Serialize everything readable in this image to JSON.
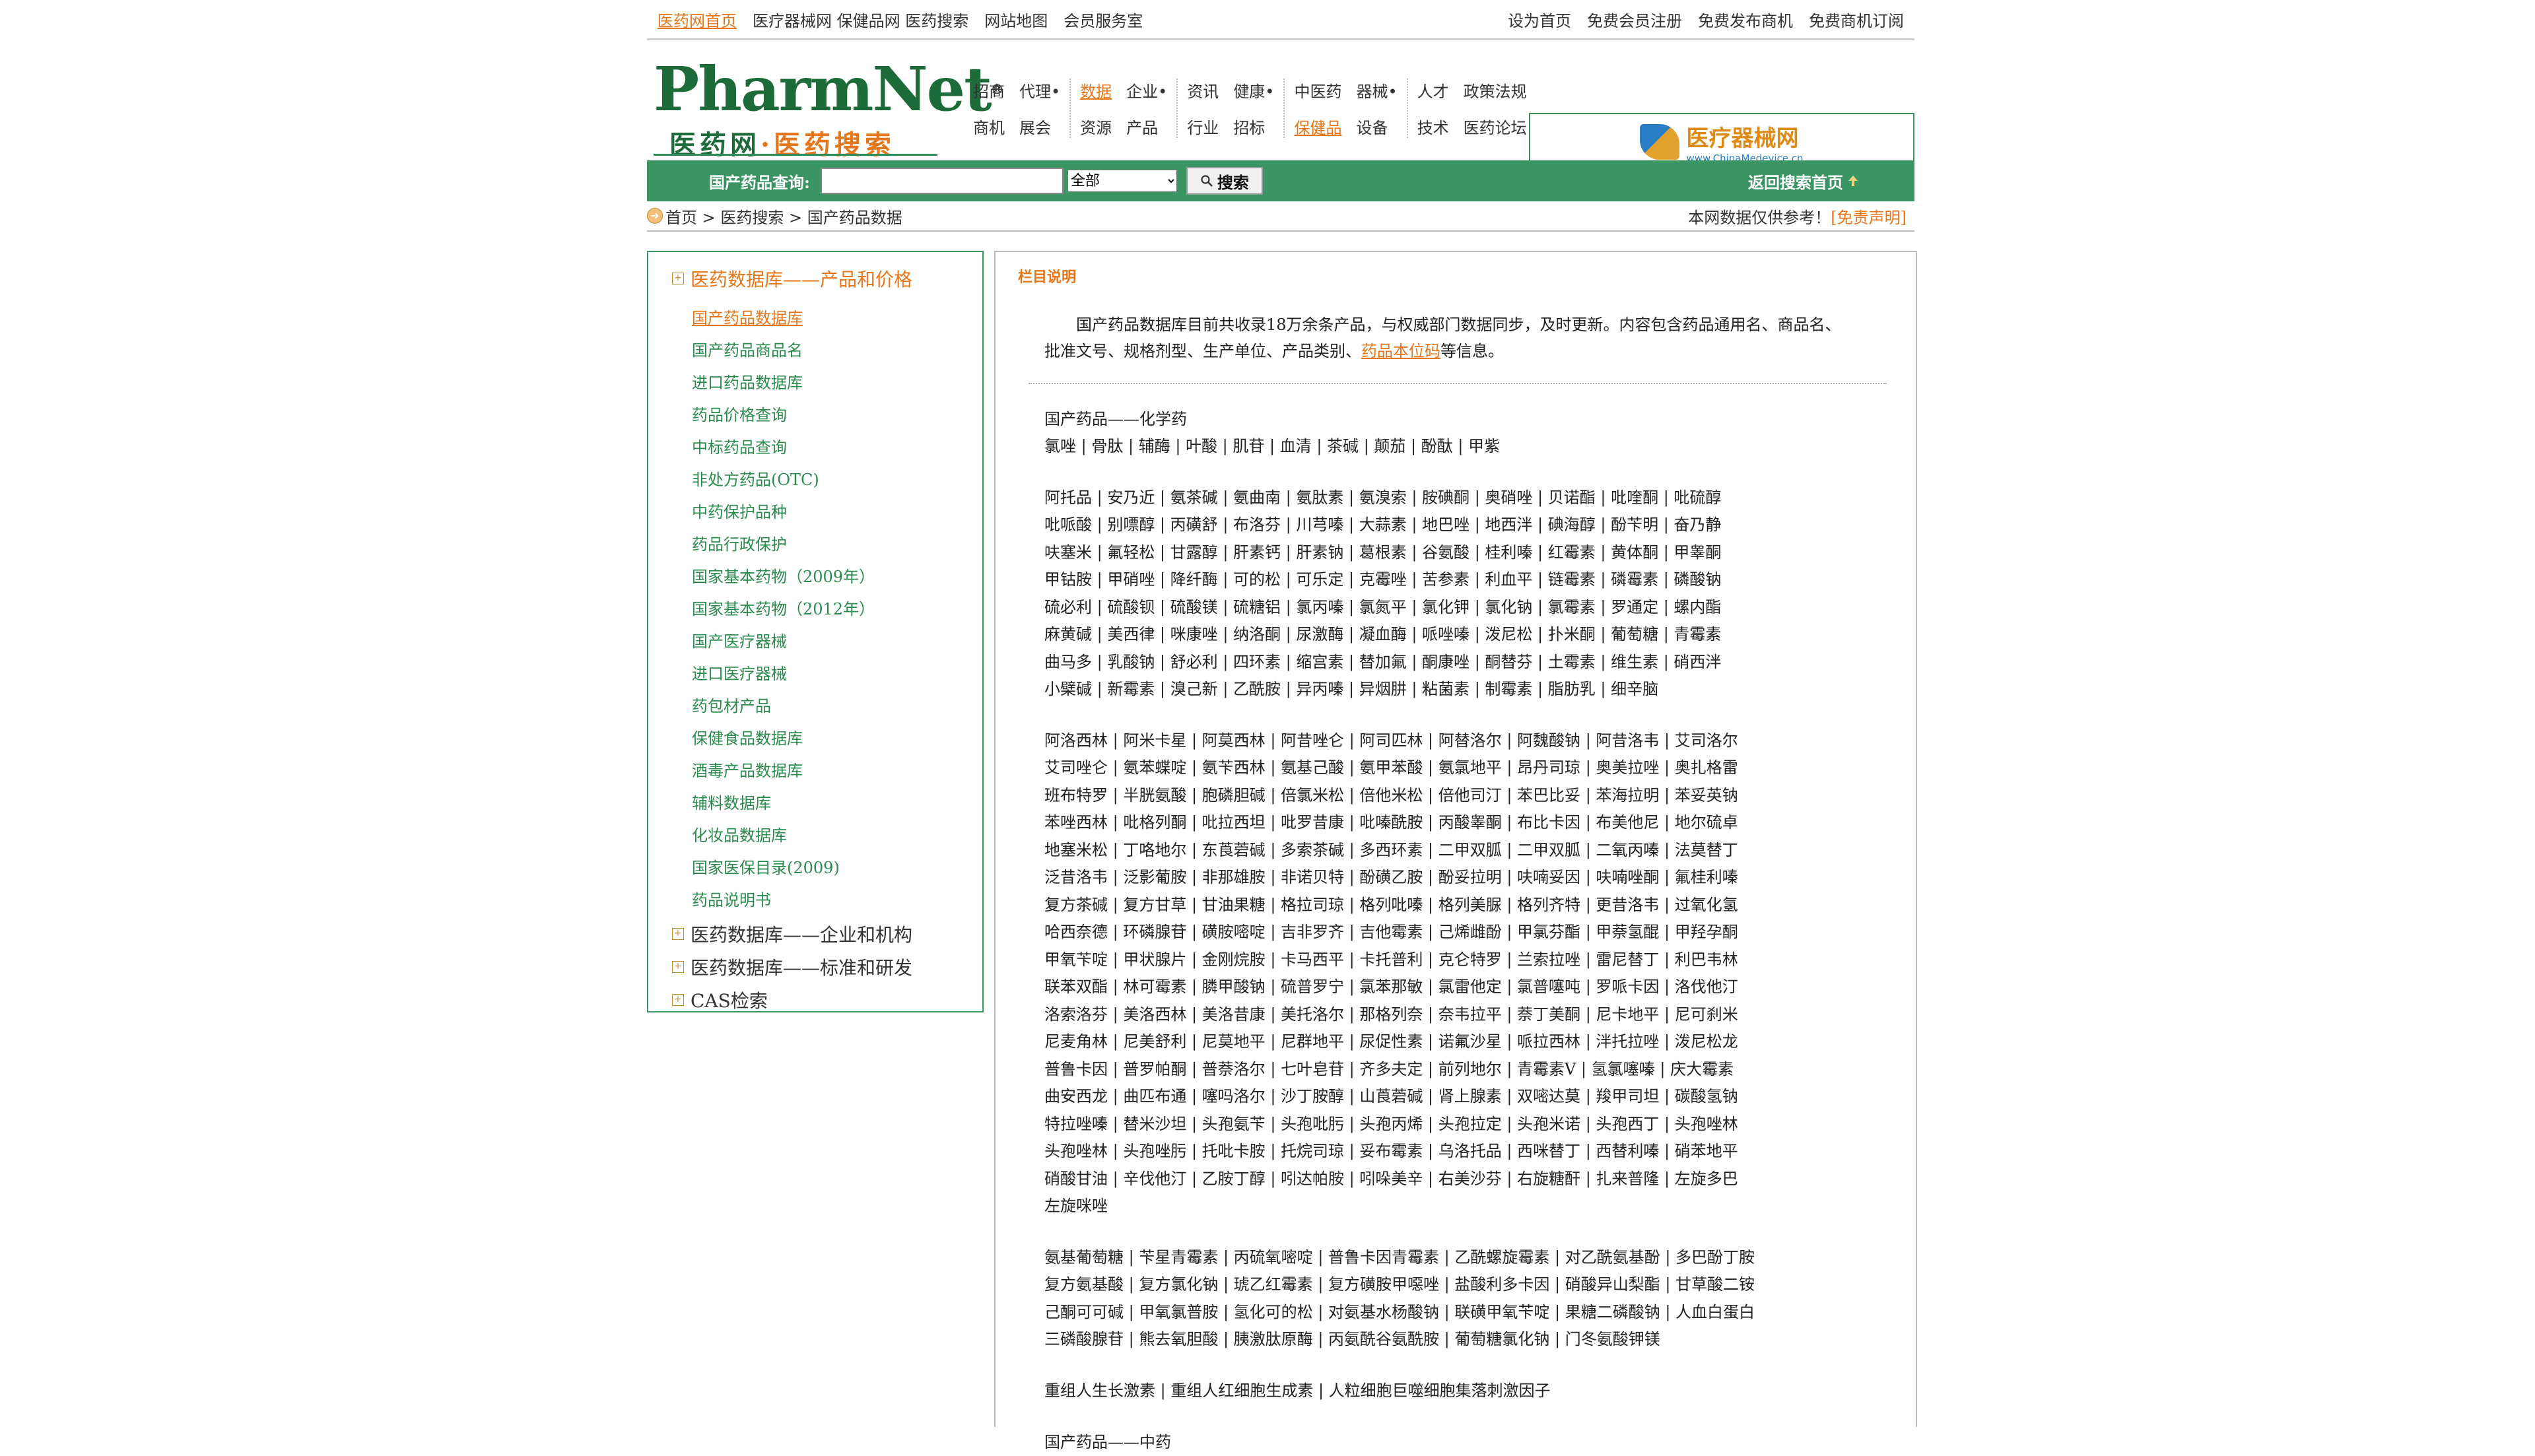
{
  "topbar": {
    "left": [
      "医药网首页",
      "医疗器械网 保健品网 医药搜索",
      "网站地图",
      "会员服务室"
    ],
    "right": [
      "设为首页",
      "免费会员注册",
      "免费发布商机",
      "免费商机订阅"
    ]
  },
  "logo": {
    "brand": "PharmNet",
    "reg": "®",
    "sub1": "医药网",
    "dot": "·",
    "sub2": "医药搜索"
  },
  "nav": {
    "col1": [
      [
        "招商",
        "代理•"
      ],
      [
        "商机",
        "展会"
      ]
    ],
    "col2": [
      [
        "数据",
        "企业•"
      ],
      [
        "资源",
        "产品"
      ]
    ],
    "col3": [
      [
        "资讯",
        "健康•"
      ],
      [
        "行业",
        "招标"
      ]
    ],
    "col4": [
      [
        "中医药",
        "器械•"
      ],
      [
        "保健品",
        "设备"
      ]
    ],
    "col5": [
      [
        "人才",
        "政策法规"
      ],
      [
        "技术",
        "医药论坛"
      ]
    ]
  },
  "banner": {
    "title": "医疗器械网",
    "url": "www.ChinaMedevice.cn"
  },
  "search": {
    "label": "国产药品查询:",
    "value": "",
    "select_value": "全部",
    "button": "搜索",
    "back": "返回搜索首页"
  },
  "crumbs": {
    "path": "首页 > 医药搜索 > 国产药品数据",
    "notice": "本网数据仅供参考！",
    "disclaimer": "[免责声明]"
  },
  "left": {
    "section1": "医药数据库——产品和价格",
    "items": [
      "国产药品数据库",
      "国产药品商品名",
      "进口药品数据库",
      "药品价格查询",
      "中标药品查询",
      "非处方药品(OTC)",
      "中药保护品种",
      "药品行政保护",
      "国家基本药物（2009年）",
      "国家基本药物（2012年）",
      "国产医疗器械",
      "进口医疗器械",
      "药包材产品",
      "保健食品数据库",
      "酒毒产品数据库",
      "辅料数据库",
      "化妆品数据库",
      "国家医保目录(2009)",
      "药品说明书"
    ],
    "section2": "医药数据库——企业和机构",
    "section3": "医药数据库——标准和研发",
    "section4": "CAS检索"
  },
  "right": {
    "title": "栏目说明",
    "intro1": "国产药品数据库目前共收录18万余条产品，与权威部门数据同步，及时更新。内容包含药品通用名、商品名、批准文号、规格剂型、生产单位、产品类别、",
    "intro_link": "药品本位码",
    "intro2": "等信息。",
    "sec_title": "国产药品——化学药",
    "group1": [
      "氯唑 | 骨肽 | 辅酶 | 叶酸 | 肌苷 | 血清 | 茶碱 | 颠茄 | 酚酞 | 甲紫"
    ],
    "group2": [
      "阿托品 | 安乃近 | 氨茶碱 | 氨曲南 | 氨肽素 | 氨溴索 | 胺碘酮 | 奥硝唑 | 贝诺酯 | 吡喹酮 | 吡硫醇",
      "吡哌酸 | 别嘌醇 | 丙磺舒 | 布洛芬 | 川芎嗪 | 大蒜素 | 地巴唑 | 地西泮 | 碘海醇 | 酚苄明 | 奋乃静",
      "呋塞米 | 氟轻松 | 甘露醇 | 肝素钙 | 肝素钠 | 葛根素 | 谷氨酸 | 桂利嗪 | 红霉素 | 黄体酮 | 甲睾酮",
      "甲钴胺 | 甲硝唑 | 降纤酶 | 可的松 | 可乐定 | 克霉唑 | 苦参素 | 利血平 | 链霉素 | 磷霉素 | 磷酸钠",
      "硫必利 | 硫酸钡 | 硫酸镁 | 硫糖铝 | 氯丙嗪 | 氯氮平 | 氯化钾 | 氯化钠 | 氯霉素 | 罗通定 | 螺内酯",
      "麻黄碱 | 美西律 | 咪康唑 | 纳洛酮 | 尿激酶 | 凝血酶 | 哌唑嗪 | 泼尼松 | 扑米酮 | 葡萄糖 | 青霉素",
      "曲马多 | 乳酸钠 | 舒必利 | 四环素 | 缩宫素 | 替加氟 | 酮康唑 | 酮替芬 | 土霉素 | 维生素 | 硝西泮",
      "小檗碱 | 新霉素 | 溴己新 | 乙酰胺 | 异丙嗪 | 异烟肼 | 粘菌素 | 制霉素 | 脂肪乳 | 细辛脑"
    ],
    "group3": [
      "阿洛西林 | 阿米卡星 | 阿莫西林 | 阿昔唑仑 | 阿司匹林 | 阿替洛尔 | 阿魏酸钠 | 阿昔洛韦 | 艾司洛尔",
      "艾司唑仑 | 氨苯蝶啶 | 氨苄西林 | 氨基己酸 | 氨甲苯酸 | 氨氯地平 | 昂丹司琼 | 奥美拉唑 | 奥扎格雷",
      "班布特罗 | 半胱氨酸 | 胞磷胆碱 | 倍氯米松 | 倍他米松 | 倍他司汀 | 苯巴比妥 | 苯海拉明 | 苯妥英钠",
      "苯唑西林 | 吡格列酮 | 吡拉西坦 | 吡罗昔康 | 吡嗪酰胺 | 丙酸睾酮 | 布比卡因 | 布美他尼 | 地尔硫卓",
      "地塞米松 | 丁咯地尔 | 东莨菪碱 | 多索茶碱 | 多西环素 | 二甲双胍 | 二甲双胍 | 二氧丙嗪 | 法莫替丁",
      "泛昔洛韦 | 泛影葡胺 | 非那雄胺 | 非诺贝特 | 酚磺乙胺 | 酚妥拉明 | 呋喃妥因 | 呋喃唑酮 | 氟桂利嗪",
      "复方茶碱 | 复方甘草 | 甘油果糖 | 格拉司琼 | 格列吡嗪 | 格列美脲 | 格列齐特 | 更昔洛韦 | 过氧化氢",
      "哈西奈德 | 环磷腺苷 | 磺胺嘧啶 | 吉非罗齐 | 吉他霉素 | 己烯雌酚 | 甲氯芬酯 | 甲萘氢醌 | 甲羟孕酮",
      "甲氧苄啶 | 甲状腺片 | 金刚烷胺 | 卡马西平 | 卡托普利 | 克仑特罗 | 兰索拉唑 | 雷尼替丁 | 利巴韦林",
      "联苯双酯 | 林可霉素 | 膦甲酸钠 | 硫普罗宁 | 氯苯那敏 | 氯雷他定 | 氯普噻吨 | 罗哌卡因 | 洛伐他汀",
      "洛索洛芬 | 美洛西林 | 美洛昔康 | 美托洛尔 | 那格列奈 | 奈韦拉平 | 萘丁美酮 | 尼卡地平 | 尼可刹米",
      "尼麦角林 | 尼美舒利 | 尼莫地平 | 尼群地平 | 尿促性素 | 诺氟沙星 | 哌拉西林 | 泮托拉唑 | 泼尼松龙",
      "普鲁卡因 | 普罗帕酮 | 普萘洛尔 | 七叶皂苷 | 齐多夫定 | 前列地尔 | 青霉素V | 氢氯噻嗪 | 庆大霉素",
      "曲安西龙 | 曲匹布通 | 噻吗洛尔 | 沙丁胺醇 | 山莨菪碱 | 肾上腺素 | 双嘧达莫 | 羧甲司坦 | 碳酸氢钠",
      "特拉唑嗪 | 替米沙坦 | 头孢氨苄 | 头孢吡肟 | 头孢丙烯 | 头孢拉定 | 头孢米诺 | 头孢西丁 | 头孢唑林",
      "头孢唑林 | 头孢唑肟 | 托吡卡胺 | 托烷司琼 | 妥布霉素 | 乌洛托品 | 西咪替丁 | 西替利嗪 | 硝苯地平",
      "硝酸甘油 | 辛伐他汀 | 乙胺丁醇 | 吲达帕胺 | 吲哚美辛 | 右美沙芬 | 右旋糖酐 | 扎来普隆 | 左旋多巴",
      "左旋咪唑"
    ],
    "group4": [
      "氨基葡萄糖 | 苄星青霉素 | 丙硫氧嘧啶 | 普鲁卡因青霉素 | 乙酰螺旋霉素 | 对乙酰氨基酚 | 多巴酚丁胺",
      "复方氨基酸 | 复方氯化钠 | 琥乙红霉素 | 复方磺胺甲噁唑 | 盐酸利多卡因 | 硝酸异山梨酯 | 甘草酸二铵",
      "己酮可可碱 | 甲氧氯普胺 | 氢化可的松 | 对氨基水杨酸钠 | 联磺甲氧苄啶 | 果糖二磷酸钠 | 人血白蛋白",
      "三磷酸腺苷 | 熊去氧胆酸 | 胰激肽原酶 | 丙氨酰谷氨酰胺 | 葡萄糖氯化钠 | 门冬氨酸钾镁"
    ],
    "group5": [
      "重组人生长激素 | 重组人红细胞生成素 | 人粒细胞巨噬细胞集落刺激因子"
    ],
    "tail_title": "国产药品——中药"
  }
}
